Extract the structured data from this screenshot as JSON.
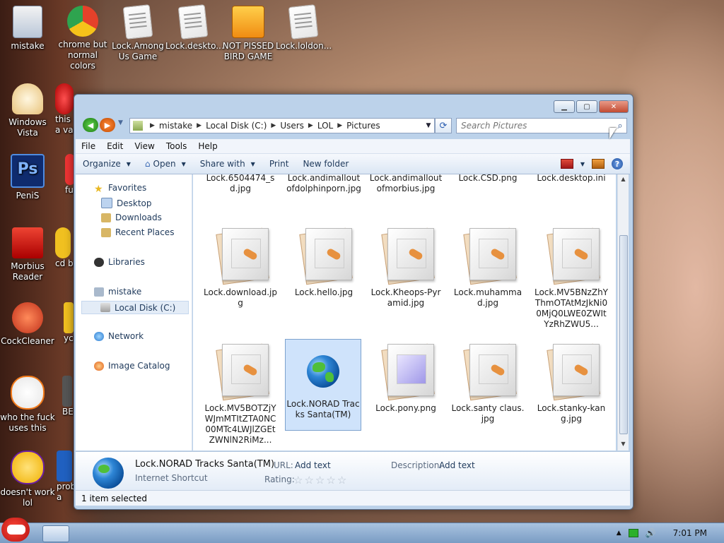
{
  "desktop": {
    "icons": [
      {
        "label": "mistake",
        "color": "#4f7cc2"
      },
      {
        "label": "chrome but normal colors",
        "color": "#e5412a"
      },
      {
        "label": "Lock.Among Us Game",
        "color": "#ffffff"
      },
      {
        "label": "Lock.deskto...",
        "color": "#ffffff"
      },
      {
        "label": "NOT PISSED BIRD GAME",
        "color": "#f3a12a"
      },
      {
        "label": "Lock.loldon...",
        "color": "#ffffff"
      },
      {
        "label": "Windows Vista",
        "color": "#e8c27a"
      },
      {
        "label": "this a va",
        "color": "#d81d1d"
      },
      {
        "label": "PeniS",
        "color": "#1c3b8f"
      },
      {
        "label": "fu",
        "color": "#e33"
      },
      {
        "label": "Morbius Reader",
        "color": "#d51616"
      },
      {
        "label": "cd b",
        "color": "#f0c020"
      },
      {
        "label": "CockCleaner",
        "color": "#e04020"
      },
      {
        "label": "yc",
        "color": "#f0c020"
      },
      {
        "label": "who the fuck uses this",
        "color": "#f27a1a"
      },
      {
        "label": "BE",
        "color": "#333"
      },
      {
        "label": "doesn't work lol",
        "color": "#6a1fa0"
      },
      {
        "label": "prob a",
        "color": "#2060c0"
      }
    ]
  },
  "window": {
    "address": {
      "crumbs": [
        "mistake",
        "Local Disk (C:)",
        "Users",
        "LOL",
        "Pictures"
      ]
    },
    "search": {
      "placeholder": "Search Pictures"
    },
    "menu": [
      "File",
      "Edit",
      "View",
      "Tools",
      "Help"
    ],
    "toolbar": {
      "organize": "Organize",
      "open": "Open",
      "share": "Share with",
      "print": "Print",
      "new_folder": "New folder"
    },
    "nav": {
      "favorites": "Favorites",
      "desktop": "Desktop",
      "downloads": "Downloads",
      "recent": "Recent Places",
      "libraries": "Libraries",
      "mistake": "mistake",
      "local_disk": "Local Disk (C:)",
      "network": "Network",
      "image_catalog": "Image Catalog"
    },
    "files": [
      {
        "name": "Lock.6504474_sd.jpg"
      },
      {
        "name": "Lock.andimalloutofdolphinporn.jpg"
      },
      {
        "name": "Lock.andimalloutofmorbius.jpg"
      },
      {
        "name": "Lock.CSD.png"
      },
      {
        "name": "Lock.desktop.ini"
      },
      {
        "name": "Lock.download.jpg"
      },
      {
        "name": "Lock.hello.jpg"
      },
      {
        "name": "Lock.Kheops-Pyramid.jpg"
      },
      {
        "name": "Lock.muhammad.jpg"
      },
      {
        "name": "Lock.MV5BNzZhYThmOTAtMzJkNi00MjQ0LWE0ZWItYzRhZWU5..."
      },
      {
        "name": "Lock.MV5BOTZjYWJmMTItZTA0NC00MTc4LWJlZGEtZWNlN2RiMz..."
      },
      {
        "name": "Lock.NORAD Tracks Santa(TM)"
      },
      {
        "name": "Lock.pony.png"
      },
      {
        "name": "Lock.santy claus.jpg"
      },
      {
        "name": "Lock.stanky-kang.jpg"
      }
    ],
    "details": {
      "name": "Lock.NORAD Tracks Santa(TM)",
      "type": "Internet Shortcut",
      "url_label": "URL:",
      "url_value": "Add text",
      "rating_label": "Rating:",
      "desc_label": "Description:",
      "desc_value": "Add text",
      "rating": 0
    },
    "status": "1 item selected"
  },
  "taskbar": {
    "clock": "7:01 PM"
  }
}
